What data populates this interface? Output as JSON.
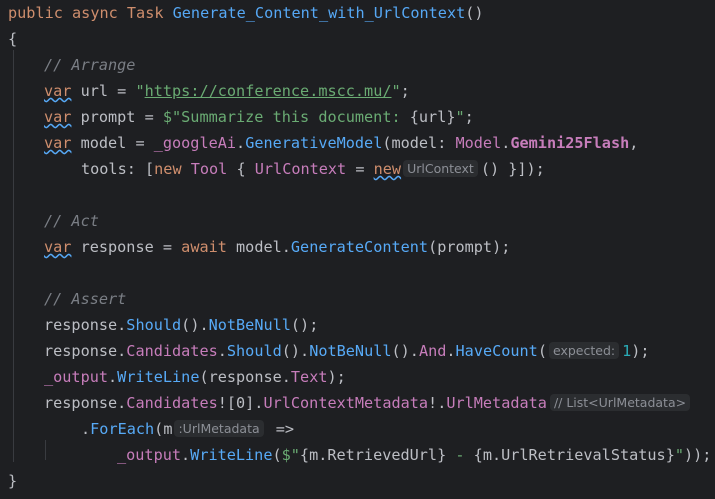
{
  "colors": {
    "background": "#1e1f22",
    "keyword": "#cf8e6d",
    "type": "#c77dbb",
    "method": "#56a8f5",
    "string": "#6aab73",
    "number": "#2aacb8",
    "comment": "#7a7e85",
    "default": "#bcbec4"
  },
  "code": {
    "l1": {
      "public": "public",
      "async": "async",
      "task": "Task",
      "method": "Generate_Content_with_UrlContext",
      "parens": "()"
    },
    "l2": {
      "brace": "{"
    },
    "l3": {
      "comment": "// Arrange"
    },
    "l4": {
      "var": "var",
      "name": " url = ",
      "q1": "\"",
      "url": "https://conference.mscc.mu/",
      "q2": "\"",
      "semi": ";"
    },
    "l5": {
      "var": "var",
      "rest_a": " prompt = ",
      "str": "$\"Summarize this document: ",
      "interp": "{url}",
      "str_end": "\"",
      "semi": ";"
    },
    "l6": {
      "var": "var",
      "a": " model = ",
      "field": "_googleAi",
      "dot": ".",
      "method": "GenerativeModel",
      "b": "(model: ",
      "cls": "Model",
      "dot2": ".",
      "member": "Gemini25Flash",
      "c": ","
    },
    "l7": {
      "indent": "    ",
      "a": "tools: [",
      "new1": "new",
      "sp": " ",
      "tool": "Tool",
      "b": " { ",
      "prop": "UrlContext",
      "c": " = ",
      "new2": "new",
      "hint": "UrlContext",
      "d": "() }]);"
    },
    "l9": {
      "comment": "// Act"
    },
    "l10": {
      "var": "var",
      "a": " response = ",
      "await": "await",
      "b": " model.",
      "method": "GenerateContent",
      "c": "(prompt);"
    },
    "l12": {
      "comment": "// Assert"
    },
    "l13": {
      "a": "response.",
      "m1": "Should",
      "b": "().",
      "m2": "NotBeNull",
      "c": "();"
    },
    "l14": {
      "a": "response.",
      "p1": "Candidates",
      "b": ".",
      "m1": "Should",
      "c": "().",
      "m2": "NotBeNull",
      "d": "().",
      "m3": "And",
      "e": ".",
      "m4": "HaveCount",
      "f": "(",
      "hint": "expected:",
      "num": "1",
      "g": ");"
    },
    "l15": {
      "field": "_output",
      "a": ".",
      "m1": "WriteLine",
      "b": "(response.",
      "p1": "Text",
      "c": ");"
    },
    "l16": {
      "a": "response.",
      "p1": "Candidates",
      "b": "![0].",
      "p2": "UrlContextMetadata",
      "c": "!.",
      "p3": "UrlMetadata",
      "hint": "// List<UrlMetadata>"
    },
    "l17": {
      "a": ".",
      "m1": "ForEach",
      "b": "(m",
      "hint": ":UrlMetadata",
      "c": " =>"
    },
    "l18": {
      "field": "_output",
      "a": ".",
      "m1": "WriteLine",
      "b": "(",
      "s1": "$\"",
      "i1": "{m.RetrievedUrl}",
      "s2": " - ",
      "i2": "{m.UrlRetrievalStatus}",
      "s3": "\"",
      "c": "));"
    },
    "l19": {
      "brace": "}"
    }
  }
}
